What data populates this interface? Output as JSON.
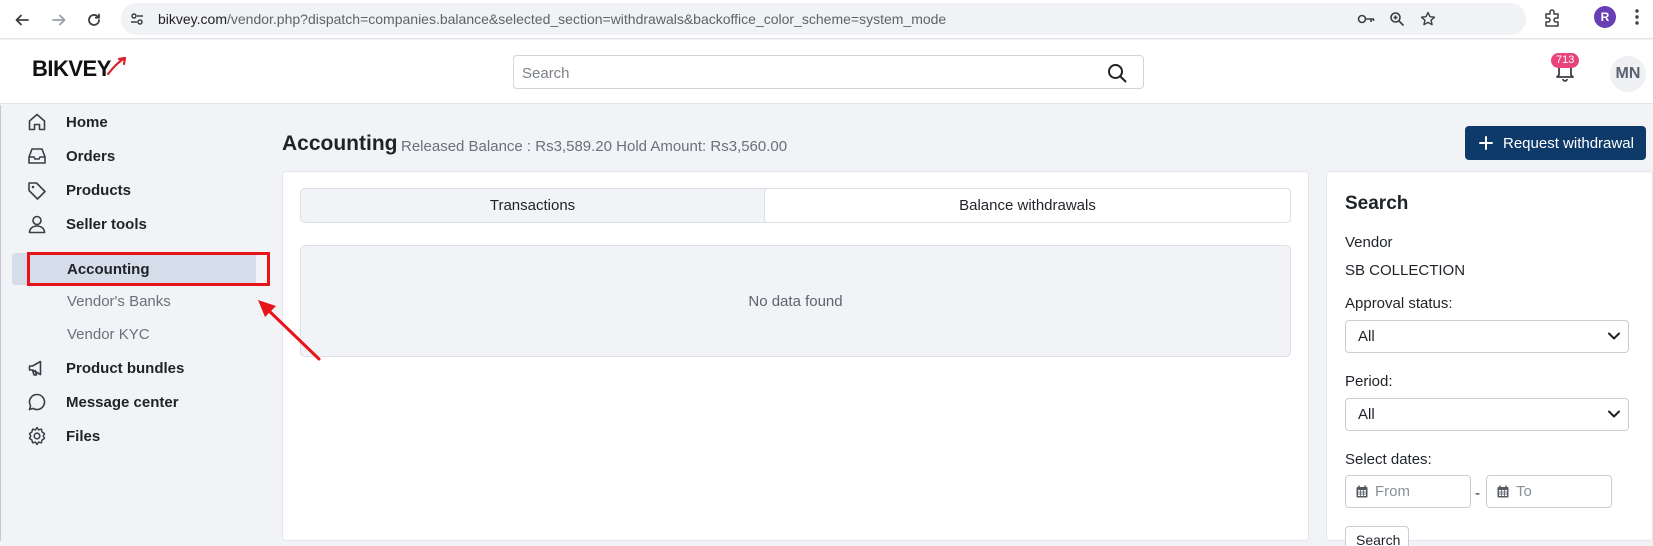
{
  "browser": {
    "url_host": "bikvey.com",
    "url_path": "/vendor.php?dispatch=companies.balance&selected_section=withdrawals&backoffice_color_scheme=system_mode",
    "profile_initial": "R"
  },
  "header": {
    "logo": "BIKVEY",
    "search_placeholder": "Search",
    "notification_count": "713",
    "user_initials": "MN"
  },
  "sidebar": {
    "items": [
      {
        "label": "Home",
        "icon": "home-icon"
      },
      {
        "label": "Orders",
        "icon": "inbox-icon"
      },
      {
        "label": "Products",
        "icon": "tag-icon"
      },
      {
        "label": "Seller tools",
        "icon": "user-icon"
      }
    ],
    "sub_items": [
      {
        "label": "Accounting",
        "active": true
      },
      {
        "label": "Vendor's Banks"
      },
      {
        "label": "Vendor KYC"
      }
    ],
    "items_after": [
      {
        "label": "Product bundles",
        "icon": "megaphone-icon"
      },
      {
        "label": "Message center",
        "icon": "chat-icon"
      },
      {
        "label": "Files",
        "icon": "gear-icon"
      }
    ]
  },
  "page": {
    "title": "Accounting",
    "subtitle": "Released Balance : Rs3,589.20 Hold Amount: Rs3,560.00",
    "request_button": "Request withdrawal",
    "tabs": [
      {
        "label": "Transactions",
        "active": false
      },
      {
        "label": "Balance withdrawals",
        "active": true
      }
    ],
    "empty_message": "No data found"
  },
  "search_panel": {
    "title": "Search",
    "vendor_label": "Vendor",
    "vendor_value": "SB COLLECTION",
    "approval_label": "Approval status:",
    "approval_value": "All",
    "period_label": "Period:",
    "period_value": "All",
    "dates_label": "Select dates:",
    "from_placeholder": "From",
    "to_placeholder": "To",
    "dash": "-",
    "search_button": "Search"
  },
  "annotation": {
    "highlight_color": "#e8141c"
  }
}
